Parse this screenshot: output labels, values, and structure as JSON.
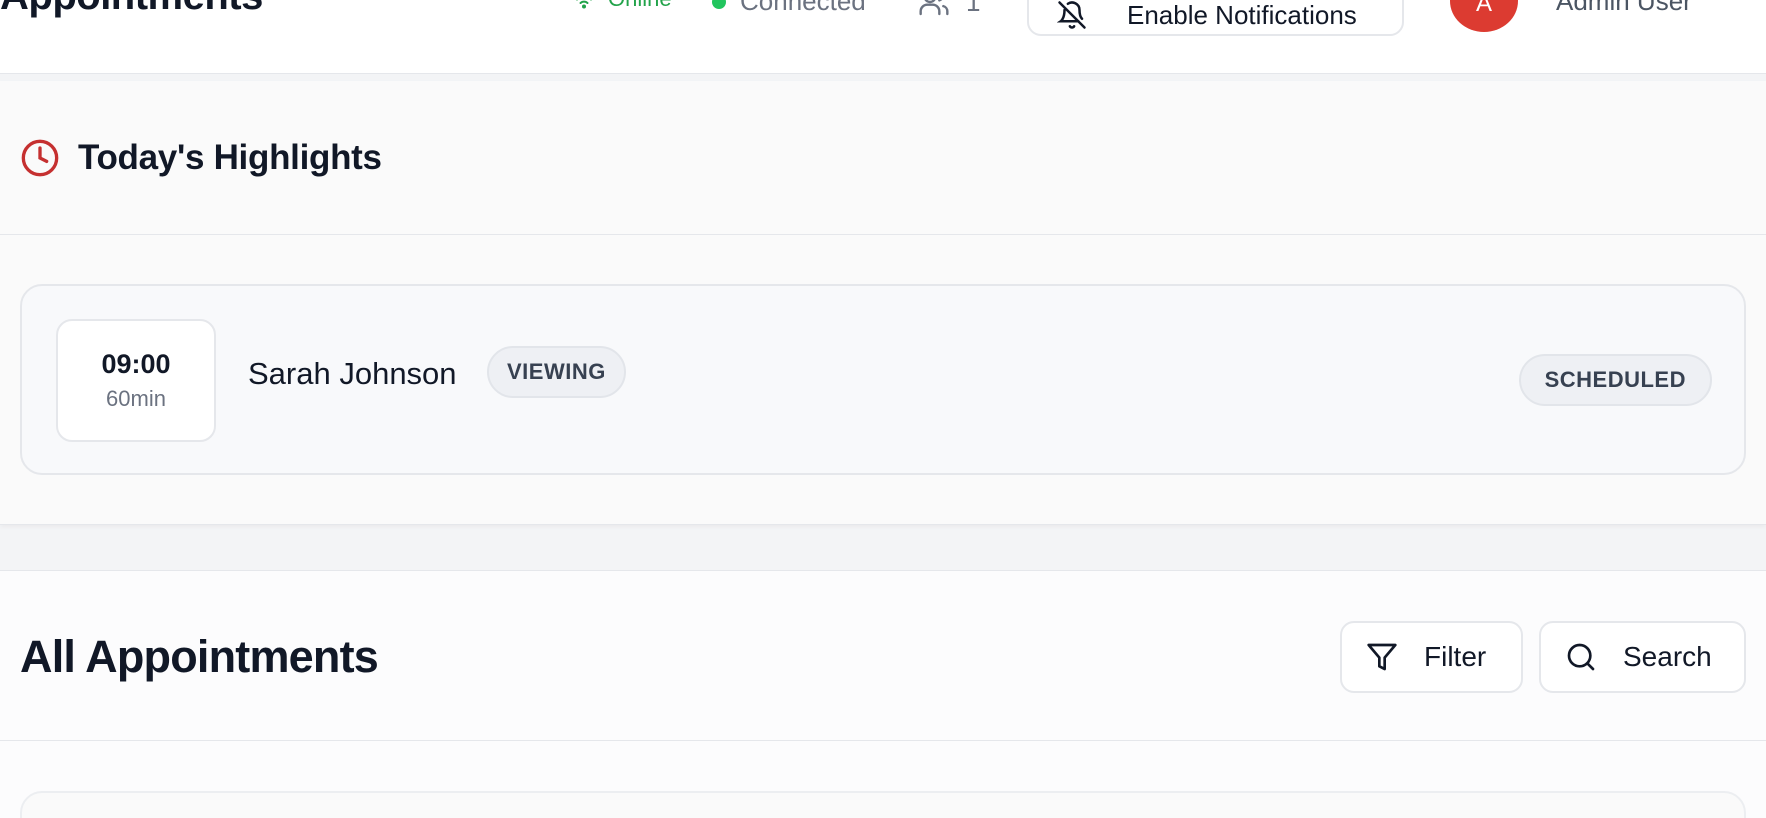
{
  "header": {
    "title": "Appointments",
    "online_label": "Online",
    "connected_label": "Connected",
    "users_count": "1",
    "notifications_label": "Enable Notifications",
    "avatar_initial": "A",
    "user_name": "Admin User",
    "online_color": "#22a34a",
    "avatar_color": "#dc3b31"
  },
  "highlights": {
    "title": "Today's Highlights",
    "icon": "clock-icon",
    "icon_color": "#c53030",
    "appointments": [
      {
        "time": "09:00",
        "duration": "60min",
        "client": "Sarah Johnson",
        "type": "VIEWING",
        "status": "SCHEDULED"
      }
    ]
  },
  "all_appointments": {
    "title": "All Appointments",
    "filter_label": "Filter",
    "search_label": "Search"
  }
}
